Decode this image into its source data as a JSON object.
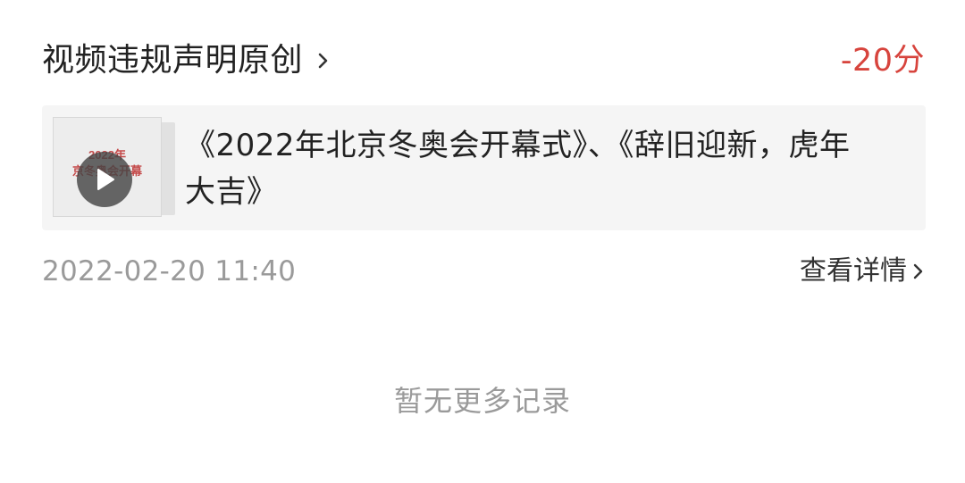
{
  "record": {
    "title": "视频违规声明原创",
    "title_chevron_icon": "chevron-right-icon",
    "penalty": "-20分",
    "penalty_color": "#d7443d",
    "video": {
      "thumbnail_text_line1": "2022年",
      "thumbnail_text_line2": "京冬奥会开幕",
      "play_icon": "play-icon",
      "title": "《2022年北京冬奥会开幕式》、《辞旧迎新，虎年大吉》"
    },
    "date": "2022-02-20 11:40",
    "details_label": "查看详情",
    "details_chevron_icon": "chevron-right-icon"
  },
  "footer": {
    "no_more_text": "暂无更多记录"
  }
}
